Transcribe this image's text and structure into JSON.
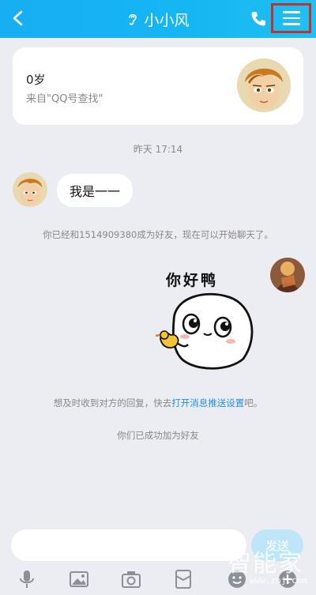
{
  "header": {
    "title": "小小风",
    "icons": [
      "back-arrow-icon",
      "ear-icon",
      "phone-icon",
      "menu-icon"
    ],
    "background_color": "#17aef2",
    "highlight_color": "#c0342f"
  },
  "profile_card": {
    "age": "0岁",
    "source": "来自\"QQ号查找\""
  },
  "chat": {
    "timestamp": "昨天 17:14",
    "incoming_message": "我是一一",
    "system_friend_added": "你已经和1514909380成为好友，现在可以开始聊天了。",
    "sticker_caption": "你好鸭",
    "notification_prefix": "想及时收到对方的回复，快去",
    "notification_link": "打开消息推送设置",
    "notification_suffix": "吧。",
    "system_success": "你们已成功加为好友"
  },
  "input": {
    "send_label": "发送",
    "send_color": "#bfe6f8"
  },
  "toolbar": {
    "icons": [
      "microphone-icon",
      "image-icon",
      "camera-icon",
      "red-packet-icon",
      "emoji-icon",
      "plus-icon"
    ]
  },
  "watermark": {
    "text": "智能家",
    "url": "www.znj.com"
  }
}
